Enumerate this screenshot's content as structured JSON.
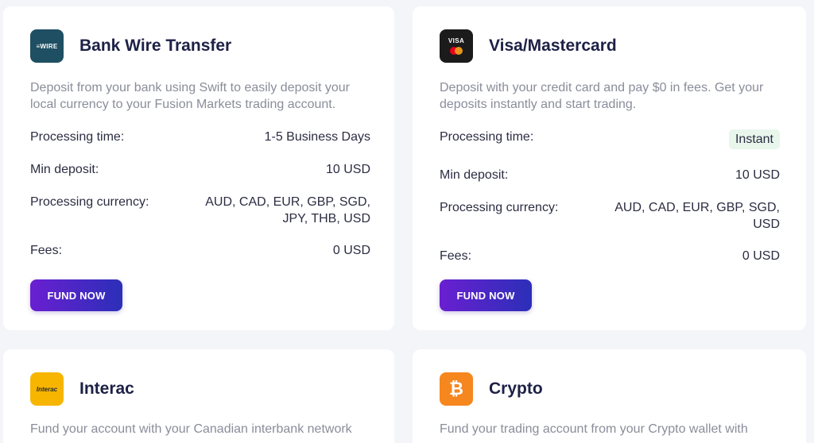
{
  "cards": {
    "wire": {
      "logo_text": "≡WIRE",
      "title": "Bank Wire Transfer",
      "description": "Deposit from your bank using Swift to easily deposit your local currency to your Fusion Markets trading account.",
      "processing_time_label": "Processing time:",
      "processing_time_value": "1-5 Business Days",
      "min_deposit_label": "Min deposit:",
      "min_deposit_value": "10 USD",
      "currency_label": "Processing currency:",
      "currency_value": "AUD, CAD, EUR, GBP, SGD, JPY, THB, USD",
      "fees_label": "Fees:",
      "fees_value": "0 USD",
      "button_label": "FUND NOW"
    },
    "visa": {
      "logo_text": "VISA",
      "title": "Visa/Mastercard",
      "description": "Deposit with your credit card and pay $0 in fees. Get your deposits instantly and start trading.",
      "processing_time_label": "Processing time:",
      "processing_time_value": "Instant",
      "min_deposit_label": "Min deposit:",
      "min_deposit_value": "10 USD",
      "currency_label": "Processing currency:",
      "currency_value": "AUD, CAD, EUR, GBP, SGD, USD",
      "fees_label": "Fees:",
      "fees_value": "0 USD",
      "button_label": "FUND NOW"
    },
    "interac": {
      "logo_text": "Interac",
      "title": "Interac",
      "description": "Fund your account with your Canadian interbank network"
    },
    "crypto": {
      "logo_text": "₿",
      "title": "Crypto",
      "description": "Fund your trading account from your Crypto wallet with"
    }
  },
  "colors": {
    "page_background": "#f4f5f8",
    "card_background": "#ffffff",
    "title": "#1d2146",
    "description": "#8a8d9a",
    "button_gradient_start": "#6a1fd1",
    "button_gradient_end": "#2b2fb8",
    "instant_badge": "#e8f6ec"
  }
}
